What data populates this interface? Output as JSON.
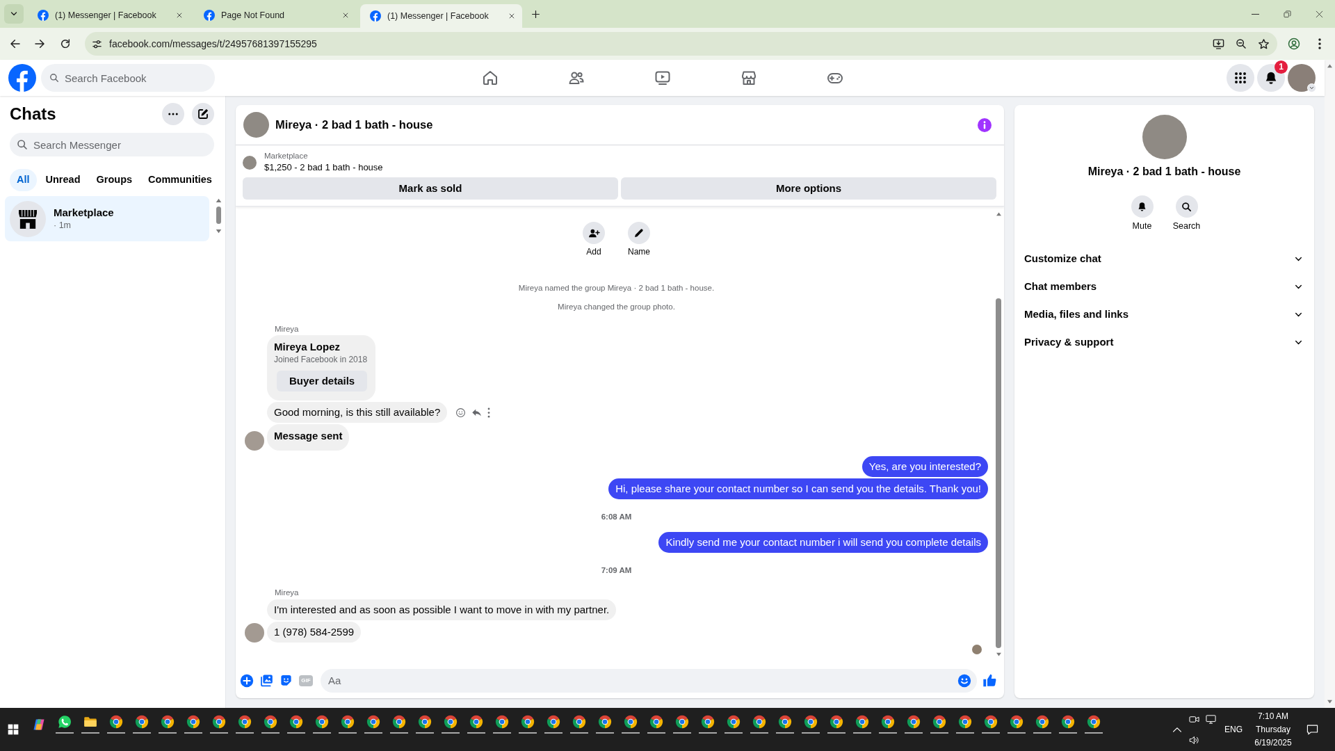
{
  "browser": {
    "tabs": [
      {
        "title": "(1) Messenger | Facebook",
        "selected": false
      },
      {
        "title": "Page Not Found",
        "selected": false
      },
      {
        "title": "(1) Messenger | Facebook",
        "selected": true
      }
    ],
    "url": "facebook.com/messages/t/24957681397155295"
  },
  "header": {
    "search": {
      "placeholder": "Search Facebook"
    },
    "nav": [
      {
        "kind": "home"
      },
      {
        "kind": "friends"
      },
      {
        "kind": "video"
      },
      {
        "kind": "marketplace"
      },
      {
        "kind": "gaming"
      }
    ],
    "notification_badge": "1"
  },
  "sidebar": {
    "title": "Chats",
    "search": {
      "placeholder": "Search Messenger"
    },
    "filters": [
      {
        "label": "All",
        "selected": true
      },
      {
        "label": "Unread",
        "selected": false
      },
      {
        "label": "Groups",
        "selected": false
      },
      {
        "label": "Communities",
        "selected": false
      }
    ],
    "chats": [
      {
        "name": "Marketplace",
        "meta": "· 1m",
        "selected": true
      }
    ]
  },
  "conversation": {
    "title": "Mireya · 2 bad 1 bath - house",
    "listing": {
      "source": "Marketplace",
      "title": "$1,250 - 2 bad 1 bath - house"
    },
    "listing_actions": [
      "Mark as sold",
      "More options"
    ],
    "group_actions": [
      {
        "kind": "add",
        "label": "Add"
      },
      {
        "kind": "name",
        "label": "Name"
      }
    ],
    "messages": [
      {
        "kind": "system",
        "text": "Mireya named the group Mireya · 2 bad 1 bath - house."
      },
      {
        "kind": "system",
        "text": "Mireya changed the group photo."
      },
      {
        "kind": "sender",
        "text": "Mireya"
      },
      {
        "kind": "profile_card",
        "name": "Mireya Lopez",
        "subtitle": "Joined Facebook in 2018",
        "button": "Buyer details"
      },
      {
        "kind": "incoming",
        "text": "Good morning, is this still available?",
        "bold": false,
        "avatar": false,
        "hovered": true
      },
      {
        "kind": "incoming",
        "text": "Message sent",
        "bold": true,
        "avatar": true,
        "hovered": false
      },
      {
        "kind": "outgoing",
        "text": "Yes, are you interested?"
      },
      {
        "kind": "outgoing",
        "text": "Hi, please share your contact number so I can send you the details. Thank you!"
      },
      {
        "kind": "timestamp",
        "text": "6:08 AM"
      },
      {
        "kind": "outgoing",
        "text": "Kindly send me your contact number i will send you complete details"
      },
      {
        "kind": "timestamp",
        "text": "7:09 AM"
      },
      {
        "kind": "sender",
        "text": "Mireya"
      },
      {
        "kind": "incoming",
        "text": "I'm interested and as soon as possible I want to move in with my partner.",
        "bold": false,
        "avatar": false,
        "hovered": false
      },
      {
        "kind": "incoming",
        "text": "1 (978) 584-2599",
        "bold": false,
        "avatar": true,
        "hovered": false
      }
    ],
    "composer": {
      "gif_label": "GIF",
      "placeholder": "Aa"
    }
  },
  "details": {
    "title": "Mireya · 2 bad 1 bath - house",
    "actions": [
      {
        "kind": "mute",
        "label": "Mute"
      },
      {
        "kind": "search",
        "label": "Search"
      }
    ],
    "sections": [
      {
        "label": "Customize chat",
        "expanded": false
      },
      {
        "label": "Chat members",
        "expanded": false
      },
      {
        "label": "Media, files and links",
        "expanded": false
      },
      {
        "label": "Privacy & support",
        "expanded": false
      }
    ]
  },
  "taskbar": {
    "apps": [
      {
        "kind": "copilot",
        "running": false
      },
      {
        "kind": "whatsapp",
        "running": true
      },
      {
        "kind": "files",
        "running": true
      },
      {
        "kind": "chrome",
        "running": true
      },
      {
        "kind": "chrome",
        "running": true
      },
      {
        "kind": "chrome",
        "running": true
      },
      {
        "kind": "chrome",
        "running": true
      },
      {
        "kind": "chrome",
        "running": true
      },
      {
        "kind": "chrome",
        "running": true
      },
      {
        "kind": "chrome",
        "running": true
      },
      {
        "kind": "chrome",
        "running": true
      },
      {
        "kind": "chrome",
        "running": true
      },
      {
        "kind": "chrome",
        "running": true
      },
      {
        "kind": "chrome",
        "running": true
      },
      {
        "kind": "chrome",
        "running": true
      },
      {
        "kind": "chrome",
        "running": true
      },
      {
        "kind": "chrome",
        "running": true
      },
      {
        "kind": "chrome",
        "running": true
      },
      {
        "kind": "chrome",
        "running": true
      },
      {
        "kind": "chrome",
        "running": true
      },
      {
        "kind": "chrome",
        "running": true
      },
      {
        "kind": "chrome",
        "running": true
      },
      {
        "kind": "chrome",
        "running": true
      },
      {
        "kind": "chrome",
        "running": true
      },
      {
        "kind": "chrome",
        "running": true
      },
      {
        "kind": "chrome",
        "running": true
      },
      {
        "kind": "chrome",
        "running": true
      },
      {
        "kind": "chrome",
        "running": true
      },
      {
        "kind": "chrome",
        "running": true
      },
      {
        "kind": "chrome",
        "running": true
      },
      {
        "kind": "chrome",
        "running": true
      },
      {
        "kind": "chrome",
        "running": true
      },
      {
        "kind": "chrome",
        "running": true
      },
      {
        "kind": "chrome",
        "running": true
      },
      {
        "kind": "chrome",
        "running": true
      },
      {
        "kind": "chrome",
        "running": true
      },
      {
        "kind": "chrome",
        "running": true
      },
      {
        "kind": "chrome",
        "running": true
      },
      {
        "kind": "chrome",
        "running": true
      },
      {
        "kind": "chrome",
        "running": true
      },
      {
        "kind": "chrome",
        "running": true
      },
      {
        "kind": "chrome",
        "running": true
      }
    ],
    "language": "ENG",
    "time": "7:10 AM",
    "day": "Thursday",
    "date": "6/19/2025"
  }
}
